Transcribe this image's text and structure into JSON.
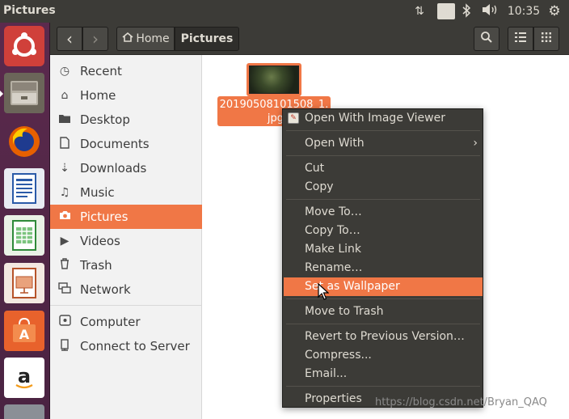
{
  "top_panel": {
    "title": "Pictures",
    "lang": "En",
    "clock": "10:35"
  },
  "header": {
    "back_glyph": "‹",
    "forward_glyph": "›",
    "breadcrumb_home": "Home",
    "breadcrumb_current": "Pictures"
  },
  "sidebar": {
    "items": [
      {
        "label": "Recent",
        "icon": "clock-icon"
      },
      {
        "label": "Home",
        "icon": "home-icon"
      },
      {
        "label": "Desktop",
        "icon": "folder-icon"
      },
      {
        "label": "Documents",
        "icon": "document-icon"
      },
      {
        "label": "Downloads",
        "icon": "download-icon"
      },
      {
        "label": "Music",
        "icon": "music-icon"
      },
      {
        "label": "Pictures",
        "icon": "camera-icon"
      },
      {
        "label": "Videos",
        "icon": "video-icon"
      },
      {
        "label": "Trash",
        "icon": "trash-icon"
      },
      {
        "label": "Network",
        "icon": "network-icon"
      },
      {
        "label": "Computer",
        "icon": "disk-icon"
      },
      {
        "label": "Connect to Server",
        "icon": "server-icon"
      }
    ],
    "active_index": 6
  },
  "file": {
    "name_line1": "20190508101508_1.",
    "name_line2": "jpg"
  },
  "context_menu": {
    "items": {
      "open_with_image_viewer": "Open With Image Viewer",
      "open_with": "Open With",
      "cut": "Cut",
      "copy": "Copy",
      "move_to": "Move To…",
      "copy_to": "Copy To…",
      "make_link": "Make Link",
      "rename": "Rename…",
      "set_as_wallpaper": "Set as Wallpaper",
      "move_to_trash": "Move to Trash",
      "revert": "Revert to Previous Version…",
      "compress": "Compress...",
      "email": "Email...",
      "properties": "Properties"
    },
    "highlighted": "set_as_wallpaper"
  },
  "watermark": "https://blog.csdn.net/Bryan_QAQ",
  "colors": {
    "accent": "#f07746",
    "panel": "#3c3b37",
    "launcher": "#5b2a4d"
  }
}
